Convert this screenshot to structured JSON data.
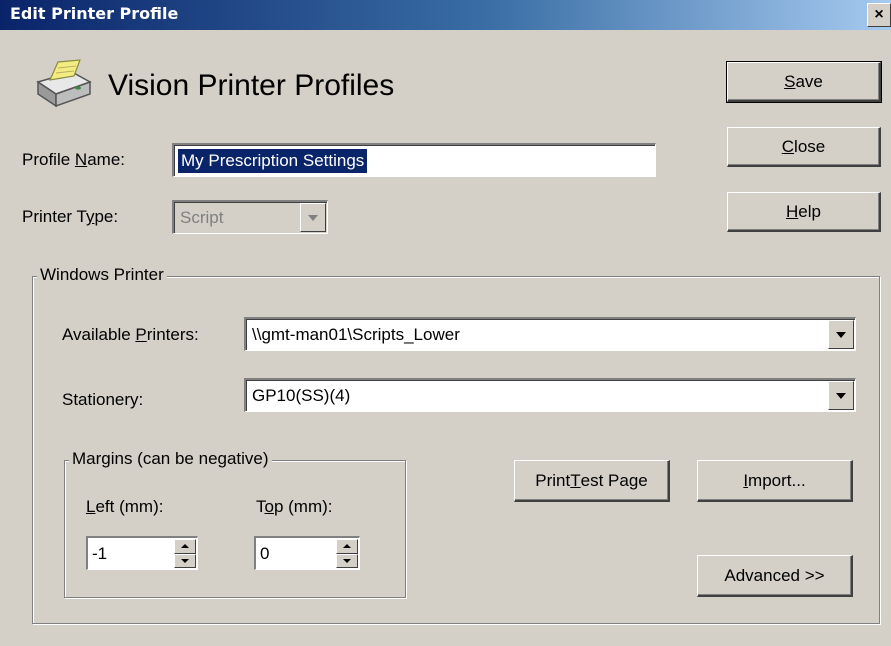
{
  "window": {
    "title": "Edit Printer Profile",
    "close_glyph": "×"
  },
  "header": {
    "icon": "printer-icon",
    "title": "Vision Printer Profiles"
  },
  "form": {
    "profile_name": {
      "label_pre": "Profile ",
      "label_key": "N",
      "label_post": "ame:",
      "value": "My Prescription Settings"
    },
    "printer_type": {
      "label_pre": "Printer T",
      "label_key": "y",
      "label_post": "pe:",
      "value": "Script"
    }
  },
  "buttons": {
    "save": {
      "key": "S",
      "rest": "ave"
    },
    "close": {
      "key": "C",
      "rest": "lose"
    },
    "help": {
      "key": "H",
      "rest": "elp"
    },
    "print_test": {
      "pre": "Print ",
      "key": "T",
      "rest": "est Page"
    },
    "import": {
      "key": "I",
      "rest": "mport..."
    },
    "advanced": "Advanced >>"
  },
  "windows_printer": {
    "legend": "Windows Printer",
    "available_printers": {
      "label_pre": "Available ",
      "label_key": "P",
      "label_post": "rinters:",
      "value": "\\\\gmt-man01\\Scripts_Lower"
    },
    "stationery": {
      "label": "Stationery:",
      "value": "GP10(SS)(4)"
    },
    "margins": {
      "legend": "Margins (can be negative)",
      "left": {
        "key": "L",
        "rest": "eft (mm):",
        "value": "-1"
      },
      "top": {
        "pre": "T",
        "key": "o",
        "rest": "p (mm):",
        "value": "0"
      }
    }
  },
  "colors": {
    "titlebar_start": "#0a246a",
    "titlebar_end": "#a6caf0",
    "face": "#d4d0c8",
    "selection": "#0a246a"
  }
}
